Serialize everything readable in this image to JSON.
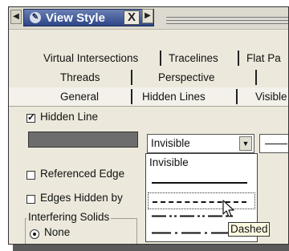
{
  "window": {
    "nav_left": "◀",
    "nav_right": "▶",
    "doc_tab": {
      "title": "View Style",
      "close": "X",
      "icon": "view-style-icon"
    }
  },
  "tabs": {
    "row1": [
      "Virtual Intersections",
      "Tracelines",
      "Flat Pa"
    ],
    "row2": [
      "Threads",
      "Perspective"
    ],
    "row3": [
      "General",
      "Hidden Lines",
      "Visible"
    ],
    "active": "Hidden Lines"
  },
  "hidden_lines": {
    "hidden_line_label": "Hidden Line",
    "hidden_line_checked": true,
    "linetype_value": "Invisible",
    "referenced_edges_label": "Referenced Edge",
    "edges_hidden_label": "Edges Hidden by",
    "interfering_solids_title": "Interfering Solids",
    "none_label": "None"
  },
  "dropdown": {
    "options": [
      {
        "text": "Invisible",
        "line": "none"
      },
      {
        "text": "",
        "line": "solid"
      },
      {
        "text": "",
        "line": "dashed"
      },
      {
        "text": "",
        "line": "dash-dot-dot"
      },
      {
        "text": "",
        "line": "long-dash-dot"
      }
    ],
    "highlighted": "dashed"
  },
  "tooltip": {
    "text": "Dashed"
  },
  "colors": {
    "title_tab": "#2c4586",
    "dialog_bg": "#ece9dc",
    "line_color_swatch": "#6d6d6d"
  }
}
